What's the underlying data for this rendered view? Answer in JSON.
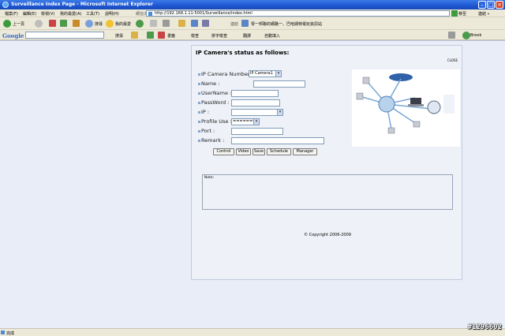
{
  "window": {
    "title": "Surveillance Index Page - Microsoft Internet Explorer"
  },
  "menubar": {
    "items": [
      "檔案(F)",
      "編輯(E)",
      "檢視(V)",
      "我的最愛(A)",
      "工具(T)",
      "說明(H)"
    ],
    "address_label": "網址(D)",
    "address_value": "http://192.168.1.11:5001/Surveillance/index.html",
    "go_label": "移至",
    "links_label": "連結 »"
  },
  "toolbar": {
    "back_label": "上一頁",
    "search_label": "搜尋",
    "favorites_label": "我的最愛",
    "links_label": "連結",
    "link_item": "零一邦聯的網路一、巴哈姆特電玩資訊站"
  },
  "googlebar": {
    "logo": "Google",
    "search_label": "搜尋",
    "bookmarks_label": "書籤",
    "check_label": "檢查",
    "spell_label": "拼字檢查",
    "translate_label": "翻譯",
    "autofill_label": "自動填入",
    "user_label": "Brook"
  },
  "panel": {
    "title": "IP Camera's status as follows:",
    "close_label": "CLOSE",
    "fields": {
      "camera_number_label": "IP Camera Number:",
      "camera_number_value": "IP Camera1",
      "name_label": "Name :",
      "username_label": "UserName :",
      "password_label": "PassWord :",
      "ip_label": "IP :",
      "profile_label": "Profile Use :",
      "profile_value": "========",
      "port_label": "Port :",
      "remark_label": "Remark :"
    },
    "buttons": {
      "control": "Control",
      "video": "Video",
      "save": "Save",
      "schedule": "Schedule",
      "manager": "Manager"
    },
    "note_label": "Note:",
    "copyright": "© Copyright 2006-2009"
  },
  "statusbar": {
    "text": "完成"
  },
  "watermark": "#1296602",
  "colors": {
    "titlebar": "#1f57d2",
    "content_bg": "#e8edf8",
    "panel_bg": "#eef1f7",
    "input_border": "#7f9db9"
  }
}
